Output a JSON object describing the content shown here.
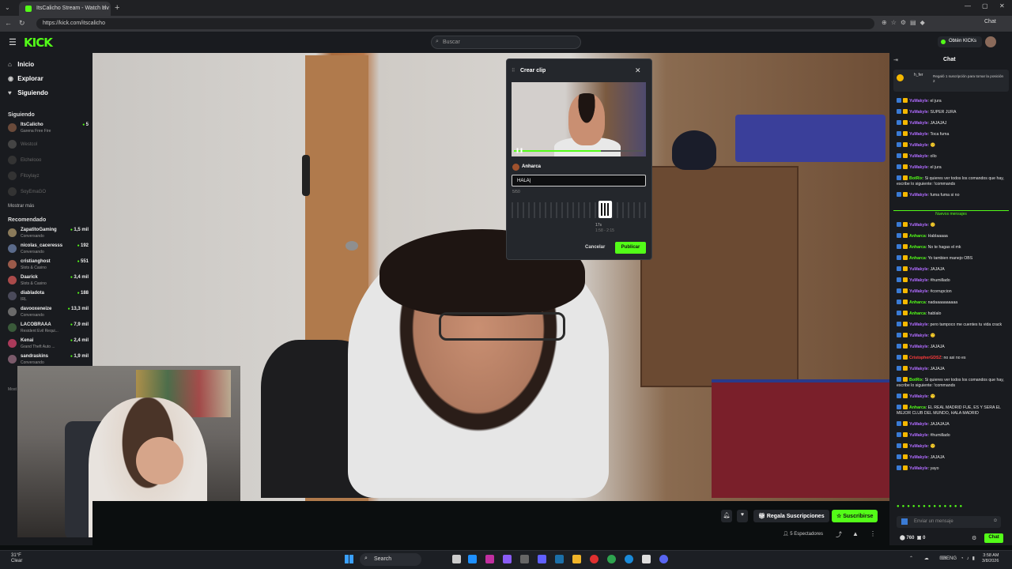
{
  "browser": {
    "tab_title": "ItsCalicho Stream - Watch Liv",
    "url": "https://kick.com/itscalicho",
    "chat_button": "Chat"
  },
  "header": {
    "logo": "KICK",
    "search_placeholder": "Buscar",
    "kicks_button": "Obtén KICKs"
  },
  "sidebar": {
    "nav": [
      {
        "label": "Inicio",
        "icon": "home-icon"
      },
      {
        "label": "Explorar",
        "icon": "compass-icon"
      },
      {
        "label": "Siguiendo",
        "icon": "heart-icon"
      }
    ],
    "following_title": "Siguiendo",
    "following": [
      {
        "name": "ItsCalicho",
        "sub": "Garena Free Fire",
        "viewers": "5",
        "live": true
      },
      {
        "name": "Westcol",
        "live": false
      },
      {
        "name": "Elchelooo",
        "live": false
      },
      {
        "name": "Fitoylayz",
        "live": false
      },
      {
        "name": "SoyEmaGO",
        "live": false
      }
    ],
    "show_more": "Mostrar más",
    "recommended_title": "Recomendado",
    "recommended": [
      {
        "name": "ZapatitoGaming",
        "sub": "Conversando",
        "viewers": "1,5 mil"
      },
      {
        "name": "nicolas_caceresss",
        "sub": "Conversando",
        "viewers": "192"
      },
      {
        "name": "cristianghost",
        "sub": "Slots & Casino",
        "viewers": "551"
      },
      {
        "name": "Daarick",
        "sub": "Slots & Casino",
        "viewers": "3,4 mil"
      },
      {
        "name": "diabladota",
        "sub": "IRL",
        "viewers": "188"
      },
      {
        "name": "davooxeneize",
        "sub": "Conversando",
        "viewers": "13,3 mil"
      },
      {
        "name": "LACOBRAAA",
        "sub": "Resident Evil Requi...",
        "viewers": "7,9 mil"
      },
      {
        "name": "Kenai",
        "sub": "Grand Theft Auto ...",
        "viewers": "2,4 mil"
      },
      {
        "name": "sandraskins",
        "sub": "Conversando",
        "viewers": "1,9 mil"
      }
    ],
    "more_label": "Most"
  },
  "clip_modal": {
    "title": "Crear clip",
    "author": "Anharca",
    "input_value": "HALA|",
    "char_count": "5/50",
    "time_main": "17s",
    "time_sub": "1:58 - 2:15",
    "cancel": "Cancelar",
    "publish": "Publicar"
  },
  "stream_bar": {
    "gift_button": "Regala Suscripciones",
    "subscribe_button": "Suscribirse",
    "viewers": "5 Espectadores"
  },
  "chat": {
    "title": "Chat",
    "pinned_user": "h_fer",
    "pinned_text": "Regaló 1 suscripción para tomar la posición 2",
    "new_messages": "Nuevos mensajes",
    "messages_top": [
      {
        "user": "YuMakyle",
        "text": "el jura",
        "color": "#b06bff"
      },
      {
        "user": "YuMakyle",
        "text": "SUPER JURA",
        "color": "#b06bff"
      },
      {
        "user": "YuMakyle",
        "text": "JAJAJAJ",
        "color": "#b06bff"
      },
      {
        "user": "YuMakyle",
        "text": "Toca fuma",
        "color": "#b06bff"
      },
      {
        "user": "YuMakyle",
        "text": "🙂",
        "color": "#b06bff"
      },
      {
        "user": "YuMakyle",
        "text": "ollo",
        "color": "#b06bff"
      },
      {
        "user": "YuMakyle",
        "text": "el jura",
        "color": "#b06bff"
      },
      {
        "user": "BotRix",
        "text": "Si quieres ver todos los comandos que hay, escribe lo siguiente: !commands",
        "color": "#53fc18"
      },
      {
        "user": "YuMakyle",
        "text": "fuma fuma si no",
        "color": "#b06bff"
      }
    ],
    "messages_bottom": [
      {
        "user": "YuMakyle",
        "text": "🙂",
        "color": "#b06bff"
      },
      {
        "user": "Anharca",
        "text": "Hablaaaaa",
        "color": "#53fc18"
      },
      {
        "user": "Anharca",
        "text": "No te hagas el mk",
        "color": "#53fc18"
      },
      {
        "user": "Anharca",
        "text": "Yo tambien manejo OBS",
        "color": "#53fc18"
      },
      {
        "user": "YuMakyle",
        "text": "JAJAJA",
        "color": "#b06bff"
      },
      {
        "user": "YuMakyle",
        "text": "#humillado",
        "color": "#b06bff"
      },
      {
        "user": "YuMakyle",
        "text": "#corrupcion",
        "color": "#b06bff"
      },
      {
        "user": "Anharca",
        "text": "nadaaaaaaaaaa",
        "color": "#53fc18"
      },
      {
        "user": "Anharca",
        "text": "hablalo",
        "color": "#53fc18"
      },
      {
        "user": "YuMakyle",
        "text": "pero tampoco me cuentes tu vida crack",
        "color": "#b06bff"
      },
      {
        "user": "YuMakyle",
        "text": "🙂",
        "color": "#b06bff"
      },
      {
        "user": "YuMakyle",
        "text": "JAJAJA",
        "color": "#b06bff"
      },
      {
        "user": "CristopherGDSZ",
        "text": "no asi no es",
        "color": "#ff3b3b"
      },
      {
        "user": "YuMakyle",
        "text": "JAJAJA",
        "color": "#b06bff"
      },
      {
        "user": "BotRix",
        "text": "Si quieres ver todos los comandos que hay, escribe lo siguiente: !commands",
        "color": "#53fc18"
      },
      {
        "user": "YuMakyle",
        "text": "🙂",
        "color": "#b06bff"
      },
      {
        "user": "Anharca",
        "text": "EL REAL MADRID FUE, ES Y SERA EL MEJOR CLUB DEL MUNDO, HALA MADRID",
        "color": "#53fc18"
      },
      {
        "user": "YuMakyle",
        "text": "JAJAJAJA",
        "color": "#b06bff"
      },
      {
        "user": "YuMakyle",
        "text": "#humillado",
        "color": "#b06bff"
      },
      {
        "user": "YuMakyle",
        "text": "🙂",
        "color": "#b06bff"
      },
      {
        "user": "YuMakyle",
        "text": "JAJAJA",
        "color": "#b06bff"
      },
      {
        "user": "YuMakyle",
        "text": "yayo",
        "color": "#b06bff"
      }
    ],
    "input_placeholder": "Enviar un mensaje",
    "points": "760",
    "points_sub": "0",
    "send_button": "Chat"
  },
  "taskbar": {
    "weather_temp": "31°F",
    "weather_desc": "Clear",
    "search": "Search",
    "lang": "ENG",
    "time": "3:58 AM",
    "date": "3/8/2026"
  },
  "colors": {
    "accent": "#53fc18",
    "panel": "#191b1f",
    "bg": "#0b0e0f"
  }
}
